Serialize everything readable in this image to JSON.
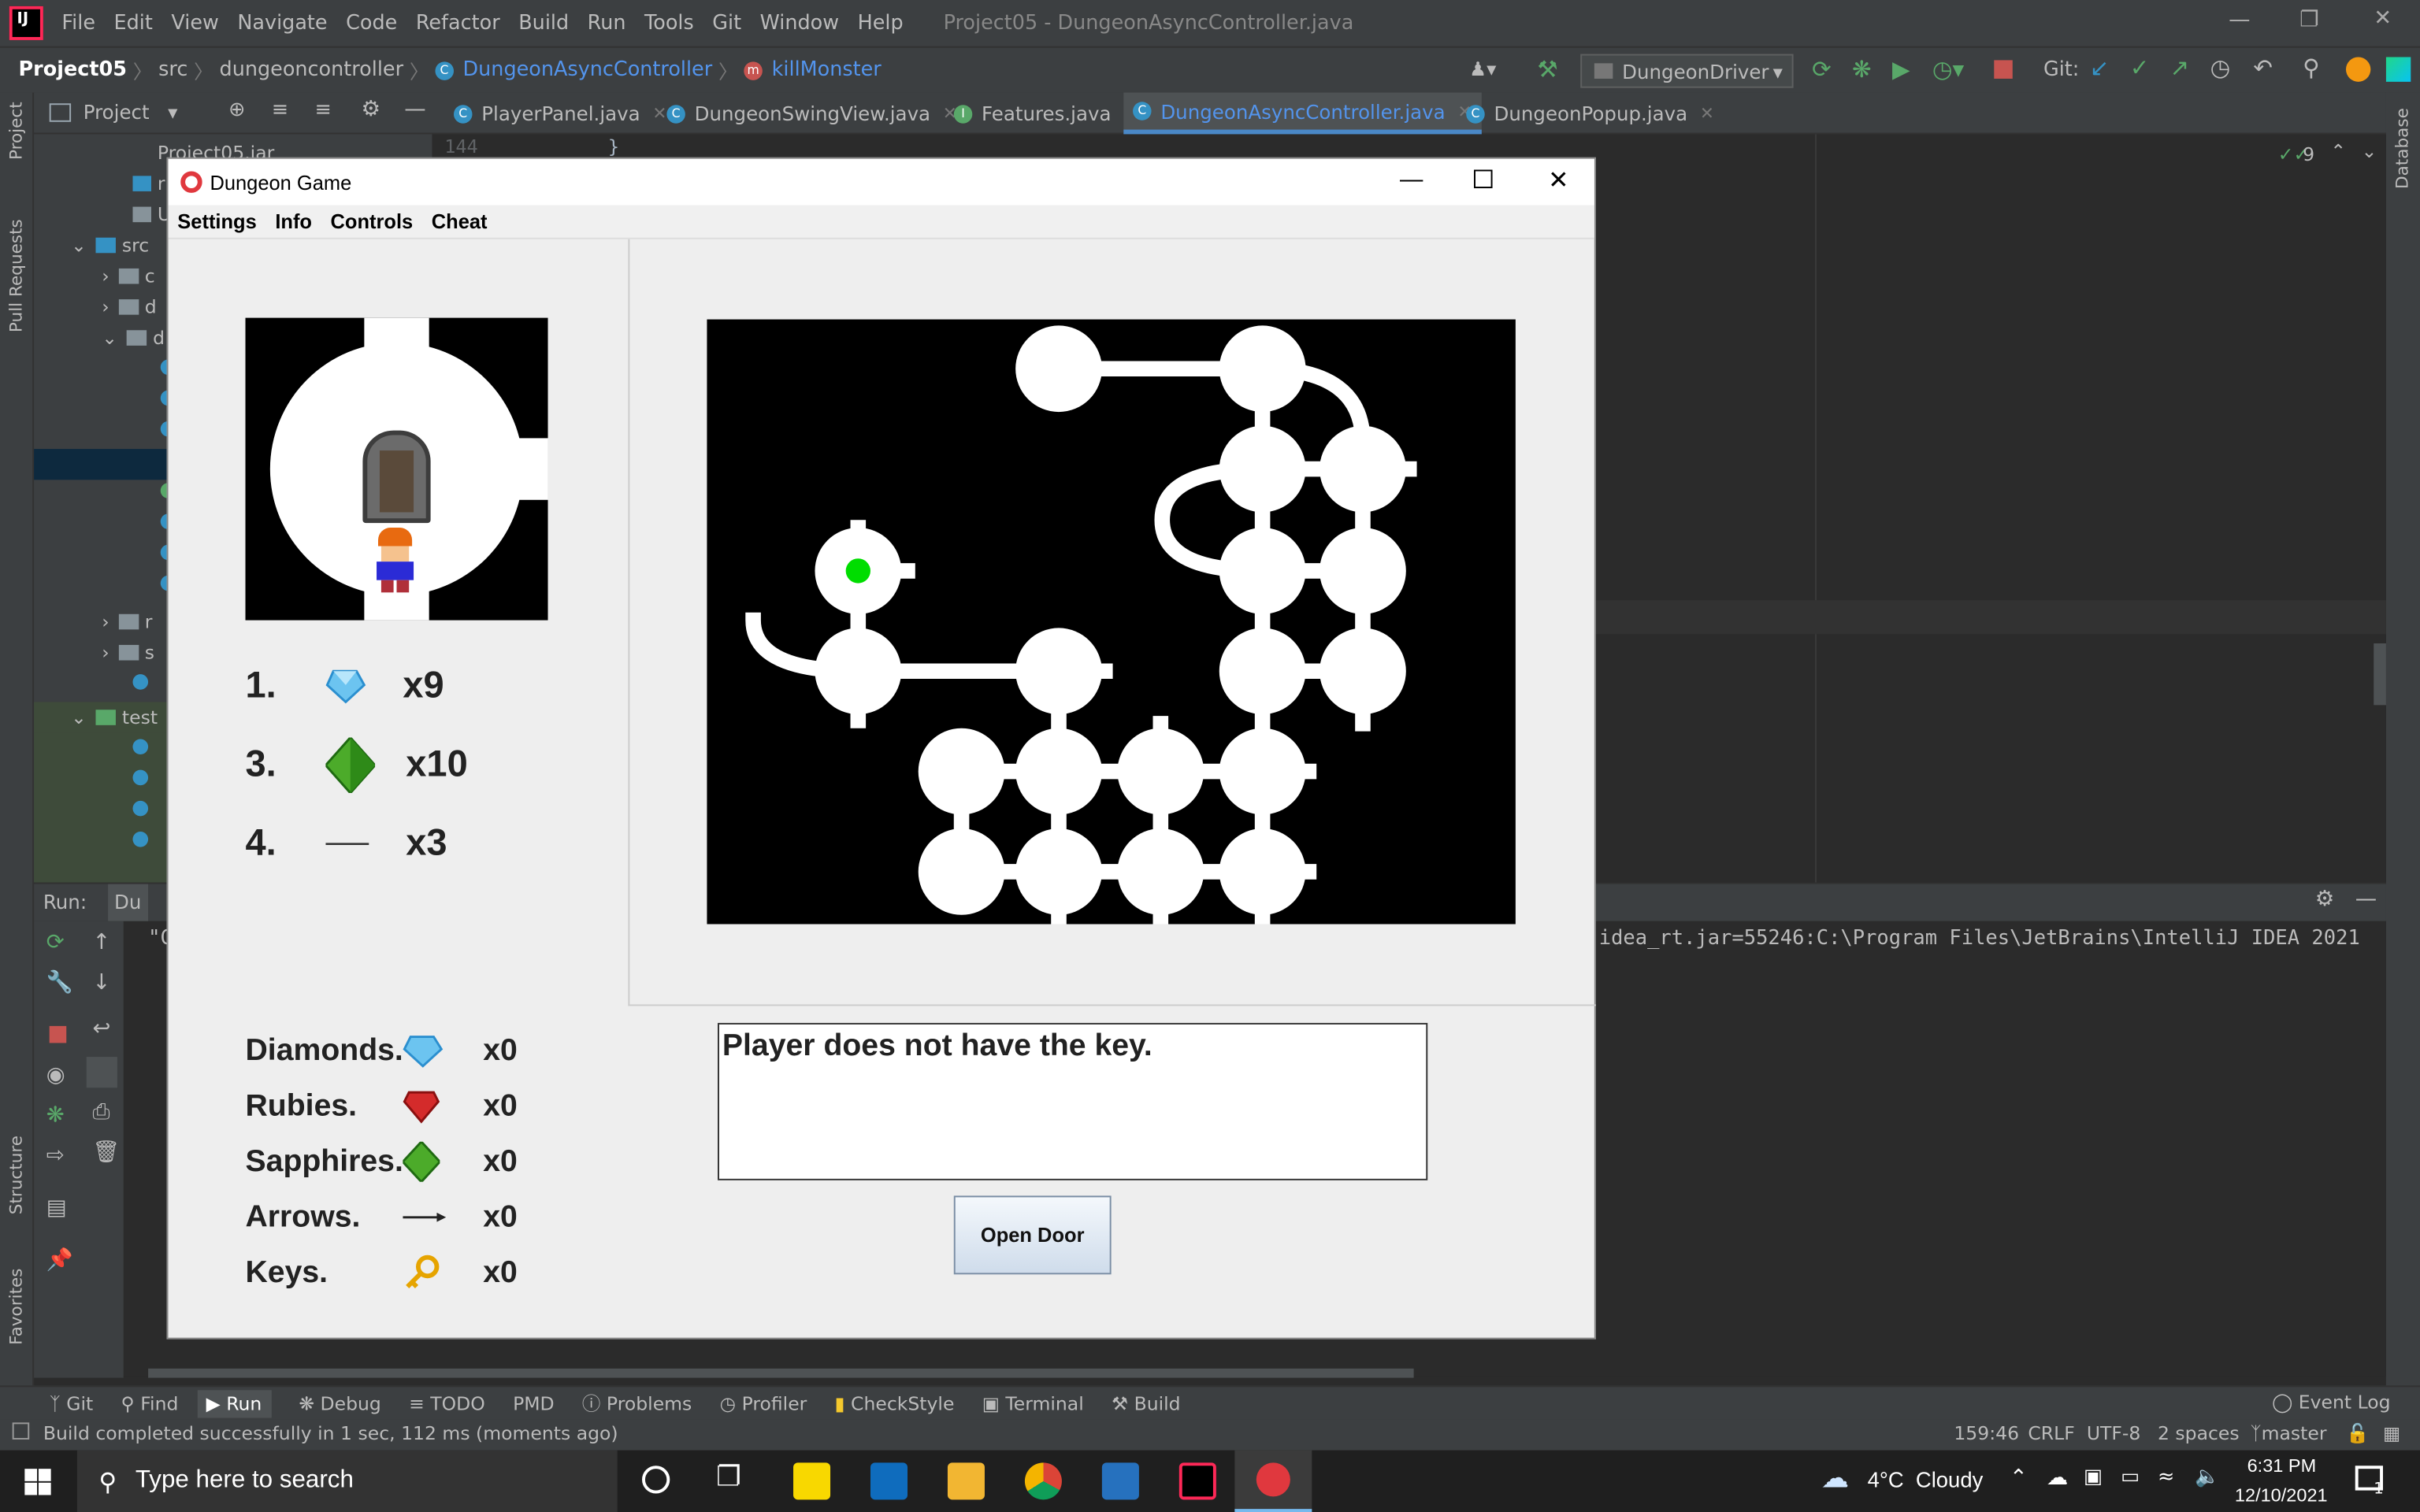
{
  "ide": {
    "menu": [
      "File",
      "Edit",
      "View",
      "Navigate",
      "Code",
      "Refactor",
      "Build",
      "Run",
      "Tools",
      "Git",
      "Window",
      "Help"
    ],
    "window_title": "Project05 - DungeonAsyncController.java",
    "breadcrumb": {
      "project": "Project05",
      "src": "src",
      "pkg": "dungeoncontroller",
      "cls": "DungeonAsyncController",
      "method": "killMonster"
    },
    "run_config": "DungeonDriver",
    "git_label": "Git:",
    "tabs": [
      "PlayerPanel.java",
      "DungeonSwingView.java",
      "Features.java",
      "DungeonAsyncController.java",
      "DungeonPopup.java"
    ],
    "project_label": "Project",
    "tree": {
      "jar": "Project05.jar",
      "src": "src",
      "test": "test"
    },
    "gutter": {
      "line": "144",
      "code": "}"
    },
    "check_count": "9",
    "run_label": "Run:",
    "run_tab": "Du",
    "console_left": "\"C",
    "console_right": "idea_rt.jar=55246:C:\\Program Files\\JetBrains\\IntelliJ IDEA 2021",
    "left_strip": [
      "Project",
      "Pull Requests",
      "Structure",
      "Favorites"
    ],
    "right_strip": "Database",
    "bottom_tools": [
      "Git",
      "Find",
      "Run",
      "Debug",
      "TODO",
      "PMD",
      "Problems",
      "Profiler",
      "CheckStyle",
      "Terminal",
      "Build"
    ],
    "event_log": "Event Log",
    "status_msg": "Build completed successfully in 1 sec, 112 ms (moments ago)",
    "status_right": {
      "pos": "159:46",
      "eol": "CRLF",
      "enc": "UTF-8",
      "indent": "2 spaces",
      "branch": "master"
    }
  },
  "dungeon": {
    "title": "Dungeon Game",
    "menu": [
      "Settings",
      "Info",
      "Controls",
      "Cheat"
    ],
    "room_items": [
      {
        "num": "1.",
        "count": "x9",
        "icon": "diamond-icon"
      },
      {
        "num": "3.",
        "count": "x10",
        "icon": "sapphire-icon"
      },
      {
        "num": "4.",
        "count": "x3",
        "icon": "arrow-icon"
      }
    ],
    "inventory": [
      {
        "label": "Diamonds.",
        "count": "x0",
        "icon": "diamond-icon"
      },
      {
        "label": "Rubies.",
        "count": "x0",
        "icon": "ruby-icon"
      },
      {
        "label": "Sapphires.",
        "count": "x0",
        "icon": "sapphire-icon"
      },
      {
        "label": "Arrows.",
        "count": "x0",
        "icon": "arrow-icon"
      },
      {
        "label": "Keys.",
        "count": "x0",
        "icon": "key-icon"
      }
    ],
    "message": "Player does not have the key.",
    "open_door": "Open Door",
    "colors": {
      "player_marker": "#00dd00",
      "map_bg": "#000000",
      "map_path": "#ffffff"
    }
  },
  "taskbar": {
    "search": "Type here to search",
    "weather": "4°C  Cloudy",
    "time": "6:31 PM",
    "date": "12/10/2021",
    "notif": "1"
  }
}
